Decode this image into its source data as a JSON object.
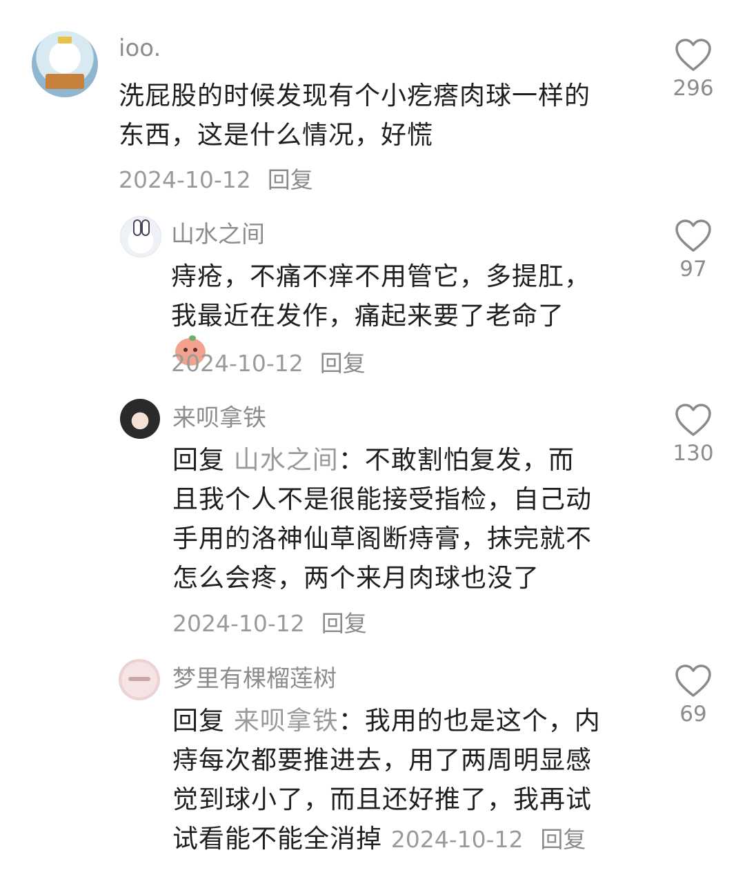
{
  "comments": [
    {
      "username": "ioo.",
      "avatar_icon": "dog-reading-book-avatar",
      "text_lines": [
        "洗屁股的时候发现有个小疙瘩肉球一样的",
        "东西，这是什么情况，好慌"
      ],
      "date": "2024-10-12",
      "reply_label": "回复",
      "likes": "296"
    },
    {
      "username": "山水之间",
      "avatar_icon": "rabbit-avatar",
      "text_lines": [
        "痔疮，不痛不痒不用管它，多提肛，",
        "我最近在发作，痛起来要了老命了"
      ],
      "emoji_icon": "crying-peach-emoji",
      "date": "2024-10-12",
      "reply_label": "回复",
      "likes": "97"
    },
    {
      "username": "来呗拿铁",
      "avatar_icon": "girl-avatar",
      "reply_prefix": "回复",
      "reply_to": "山水之间",
      "text_lines": [
        "：不敢割怕复发，而",
        "且我个人不是很能接受指检，自己动",
        "手用的洛神仙草阁断痔膏，抹完就不",
        "怎么会疼，两个来月肉球也没了"
      ],
      "date": "2024-10-12",
      "reply_label": "回复",
      "likes": "130"
    },
    {
      "username": "梦里有棵榴莲树",
      "avatar_icon": "pink-logo-avatar",
      "reply_prefix": "回复",
      "reply_to": "来呗拿铁",
      "text_lines": [
        "：我用的也是这个，内",
        "痔每次都要推进去，用了两周明显感",
        "觉到球小了，而且还好推了，我再试",
        "试看能不能全消掉"
      ],
      "date": "2024-10-12",
      "reply_label": "回复",
      "likes": "69"
    }
  ],
  "colors": {
    "text": "#1f1f1f",
    "secondary": "#8c8c8c",
    "heart_stroke": "#8a8a8a"
  }
}
